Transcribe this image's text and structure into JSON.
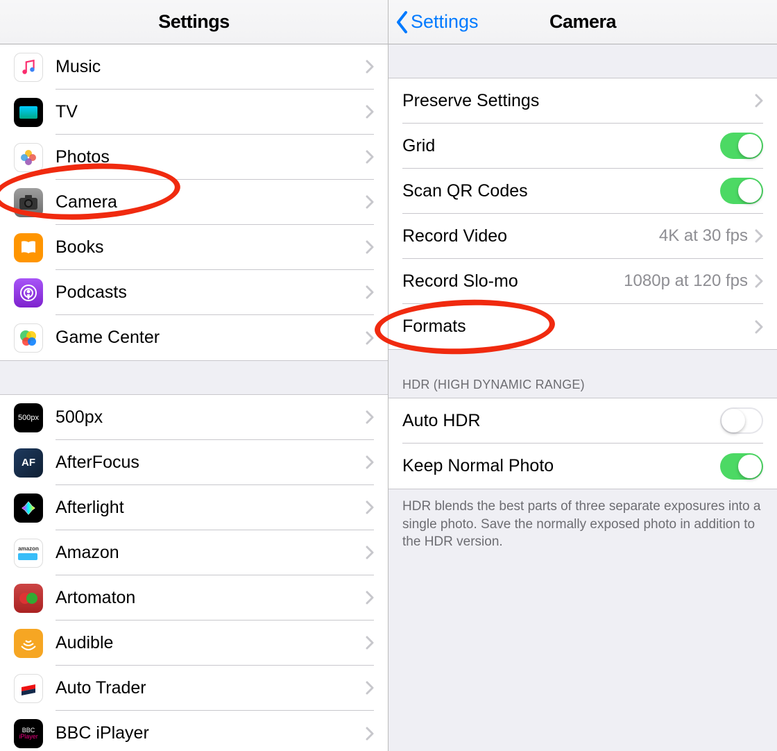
{
  "left": {
    "title": "Settings",
    "section1": [
      {
        "id": "music",
        "label": "Music"
      },
      {
        "id": "tv",
        "label": "TV"
      },
      {
        "id": "photos",
        "label": "Photos"
      },
      {
        "id": "camera",
        "label": "Camera"
      },
      {
        "id": "books",
        "label": "Books"
      },
      {
        "id": "podcasts",
        "label": "Podcasts"
      },
      {
        "id": "gamecenter",
        "label": "Game Center"
      }
    ],
    "section2": [
      {
        "id": "500px",
        "label": "500px"
      },
      {
        "id": "afterfocus",
        "label": "AfterFocus"
      },
      {
        "id": "afterlight",
        "label": "Afterlight"
      },
      {
        "id": "amazon",
        "label": "Amazon"
      },
      {
        "id": "artomaton",
        "label": "Artomaton"
      },
      {
        "id": "audible",
        "label": "Audible"
      },
      {
        "id": "autotrader",
        "label": "Auto Trader"
      },
      {
        "id": "bbc",
        "label": "BBC iPlayer"
      }
    ]
  },
  "right": {
    "back": "Settings",
    "title": "Camera",
    "rows": {
      "preserve": "Preserve Settings",
      "grid": "Grid",
      "scanqr": "Scan QR Codes",
      "recordvideo_label": "Record Video",
      "recordvideo_value": "4K at 30 fps",
      "recordslomo_label": "Record Slo-mo",
      "recordslomo_value": "1080p at 120 fps",
      "formats": "Formats",
      "hdr_header": "HDR (HIGH DYNAMIC RANGE)",
      "autohdr": "Auto HDR",
      "keepnormal": "Keep Normal Photo",
      "hdr_footer": "HDR blends the best parts of three separate exposures into a single photo. Save the normally exposed photo in addition to the HDR version."
    },
    "toggles": {
      "grid": true,
      "scanqr": true,
      "autohdr": false,
      "keepnormal": true
    }
  }
}
